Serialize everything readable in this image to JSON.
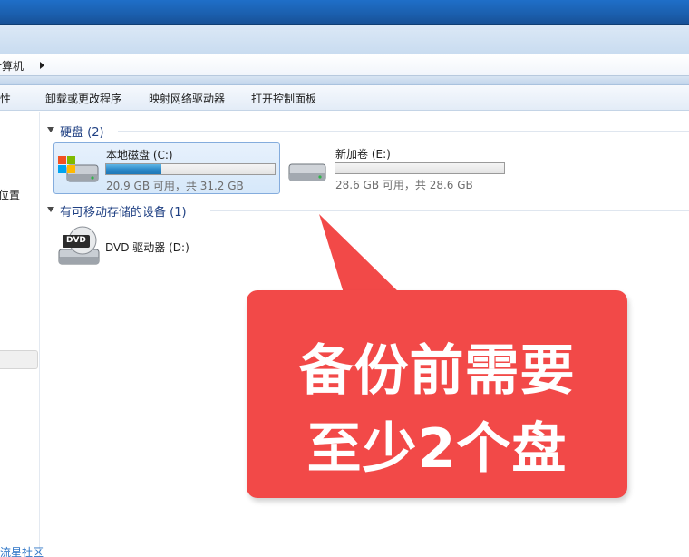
{
  "address": {
    "path": "计算机"
  },
  "toolbar": {
    "items": [
      "属性",
      "卸载或更改程序",
      "映射网络驱动器",
      "打开控制面板"
    ]
  },
  "nav": {
    "partial_item": "位置",
    "footer_link": "流星社区"
  },
  "groups": {
    "hard_disks": "硬盘 (2)",
    "removable": "有可移动存储的设备 (1)"
  },
  "drives": [
    {
      "name": "本地磁盘 (C:)",
      "free_text": "20.9 GB 可用，共 31.2 GB",
      "used_fraction": 0.33
    },
    {
      "name": "新加卷 (E:)",
      "free_text": "28.6 GB 可用，共 28.6 GB",
      "used_fraction": 0.0
    }
  ],
  "dvd": {
    "name": "DVD 驱动器 (D:)",
    "badge": "DVD"
  },
  "callout": {
    "line1": "备份前需要",
    "line2": "至少2个盘",
    "color": "#f24948"
  },
  "icons": [
    "windows-drive-icon",
    "hard-drive-icon",
    "dvd-drive-icon",
    "collapse-arrow-icon",
    "breadcrumb-arrow-icon"
  ]
}
